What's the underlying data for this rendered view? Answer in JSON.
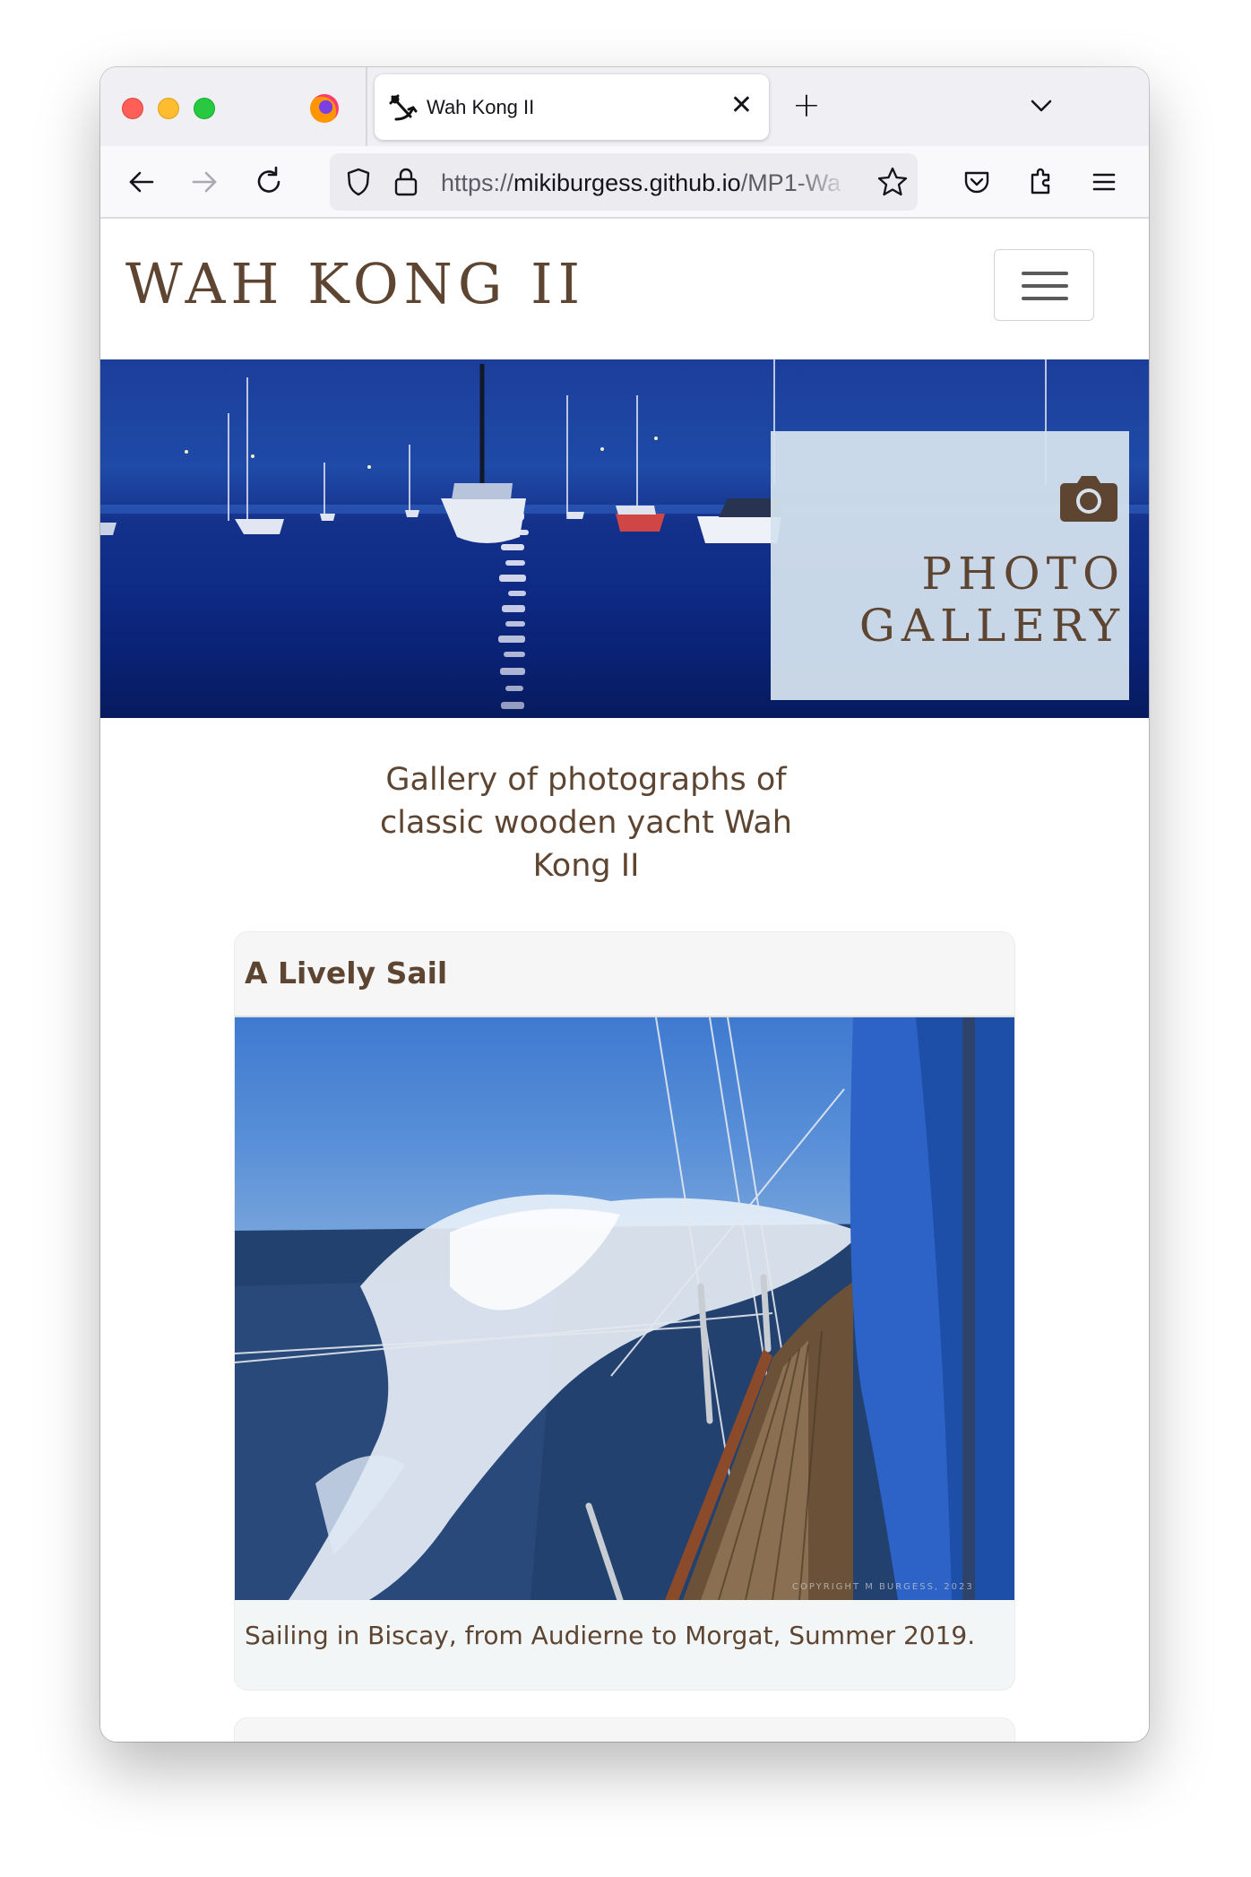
{
  "browser": {
    "tab": {
      "title": "Wah Kong II",
      "close": "✕"
    },
    "new_tab": "+",
    "url": {
      "scheme": "https://",
      "host": "mikiburgess.github.io",
      "path": "/MP1-Wa"
    }
  },
  "site": {
    "brand": "WAH KONG II",
    "hero": {
      "title_line1": "PHOTO",
      "title_line2": "GALLERY"
    },
    "intro": "Gallery of photographs of classic wooden yacht Wah Kong II"
  },
  "gallery": {
    "cards": [
      {
        "title": "A Lively Sail",
        "caption": "Sailing in Biscay, from Audierne to Morgat, Summer 2019.",
        "watermark": "Copyright M Burgess, 2023"
      }
    ]
  },
  "colors": {
    "brand_brown": "#5e4532",
    "hero_overlay": "#d5e2ee",
    "night_sea": "#0e2b86"
  }
}
